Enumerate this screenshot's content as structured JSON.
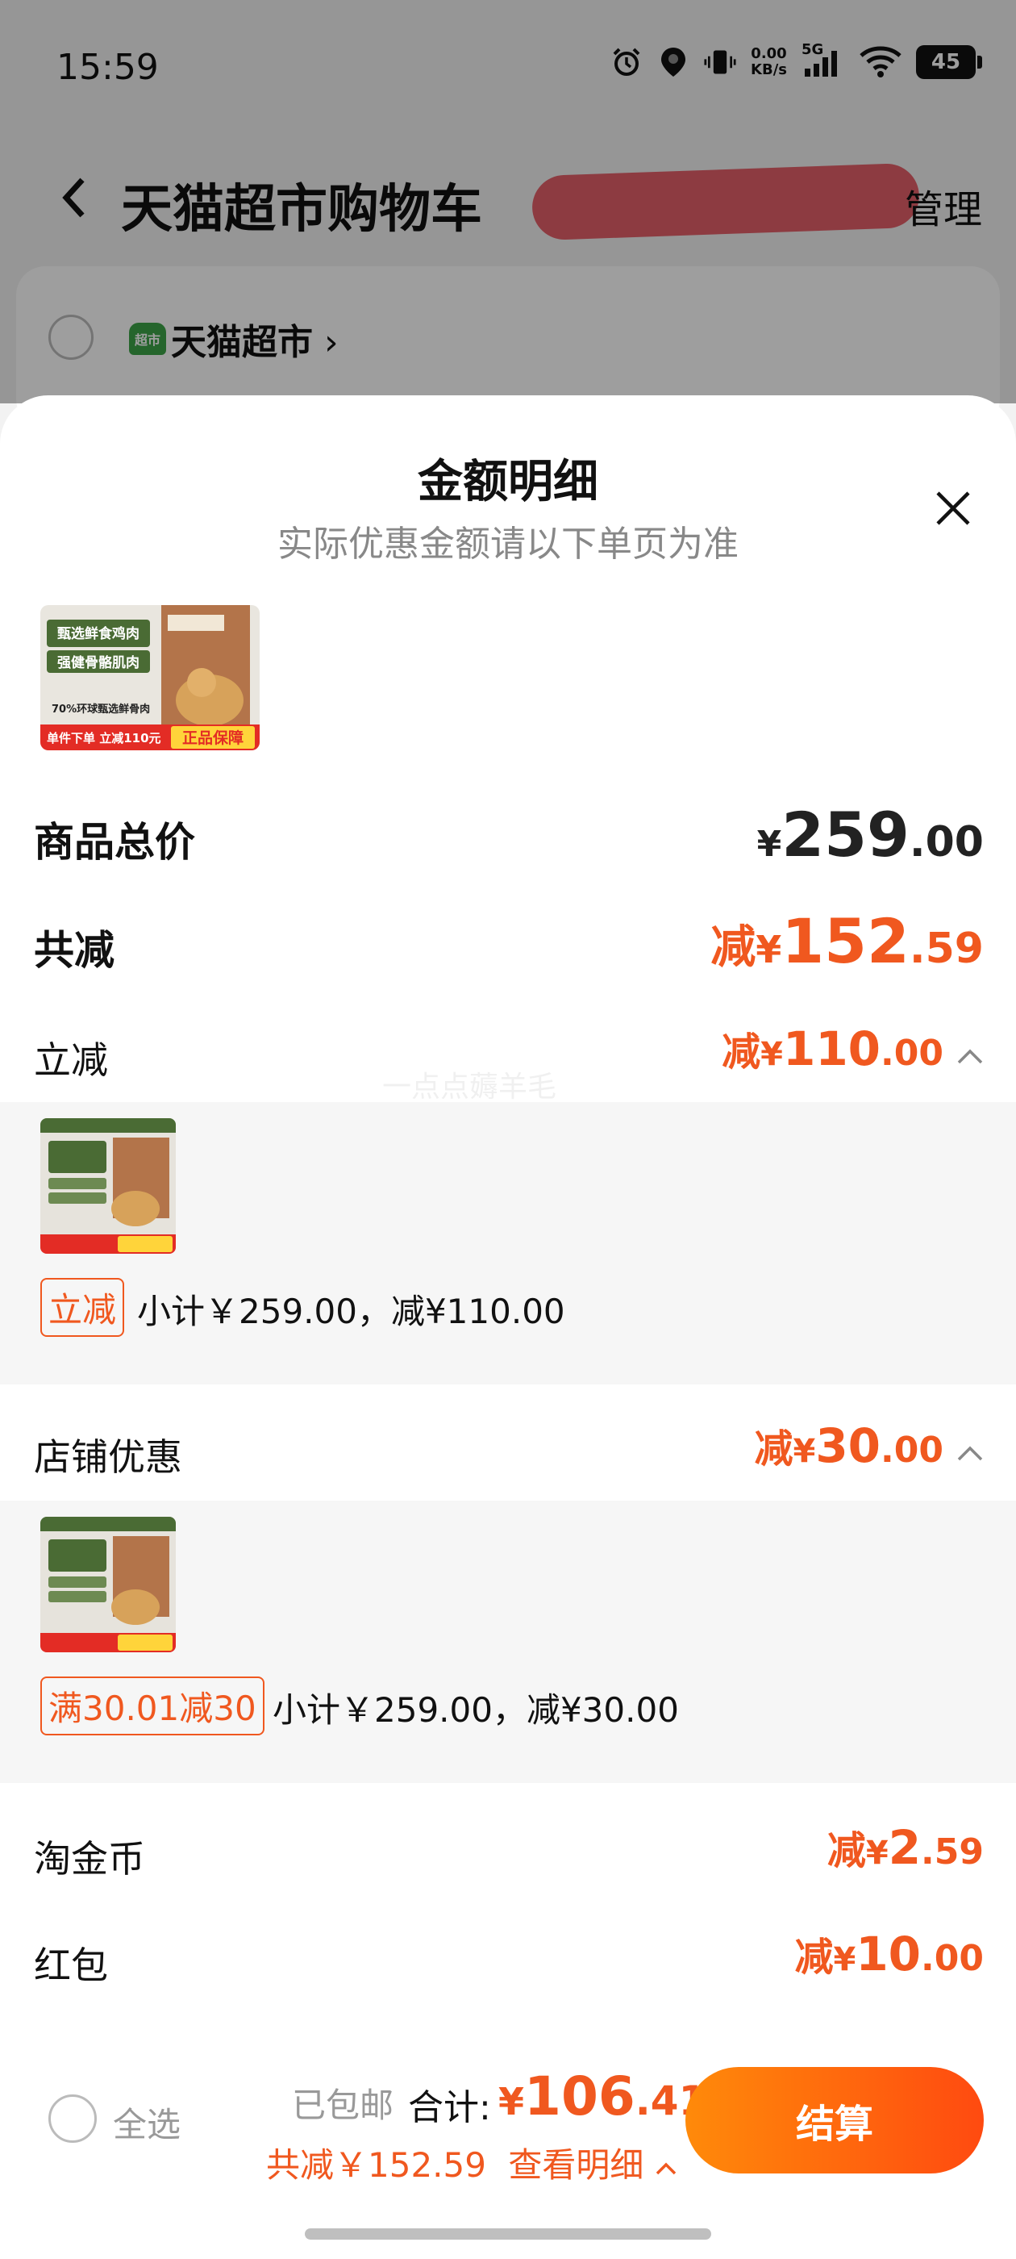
{
  "status_bar": {
    "time": "15:59",
    "net_speed_value": "0.00",
    "net_speed_unit": "KB/s",
    "network": "5G",
    "battery": "45"
  },
  "cart_page": {
    "back_icon": "chevron-left-icon",
    "title": "天猫超市购物车",
    "manage_label": "管理",
    "store_name": "天猫超市",
    "store_logo_text": "超市"
  },
  "sheet": {
    "title": "金额明细",
    "subtitle": "实际优惠金额请以下单页为准",
    "close_icon": "close-icon",
    "product_image": {
      "headline": "甄选鲜食鸡肉",
      "headline2": "强健骨骼肌肉",
      "stat": "70%环球甄选鲜骨肉",
      "promo": "单件下单 立减110元",
      "badge": "正品保障"
    },
    "goods_total": {
      "label": "商品总价",
      "yen": "¥",
      "int": "259",
      "dec": ".00"
    },
    "total_discount": {
      "label": "共减",
      "prefix": "减",
      "yen": "¥",
      "int": "152",
      "dec": ".59"
    },
    "instant_discount": {
      "label": "立减",
      "prefix": "减",
      "yen": "¥",
      "int": "110",
      "dec": ".00",
      "tag": "立减",
      "subtotal": "小计￥259.00，减¥110.00"
    },
    "store_discount": {
      "label": "店铺优惠",
      "prefix": "减",
      "yen": "¥",
      "int": "30",
      "dec": ".00",
      "tag": "满30.01减30",
      "subtotal": "小计￥259.00，减¥30.00"
    },
    "gold_coins": {
      "label": "淘金币",
      "prefix": "减",
      "yen": "¥",
      "int": "2",
      "dec": ".59"
    },
    "red_packet": {
      "label": "红包",
      "prefix": "减",
      "yen": "¥",
      "int": "10",
      "dec": ".00"
    },
    "watermark": "一点点薅羊毛"
  },
  "footer": {
    "select_all": "全选",
    "free_shipping": "已包邮",
    "total_label": "合计:",
    "total_yen": "¥",
    "total_int": "106",
    "total_dec": ".41",
    "discount_summary": "共减￥152.59",
    "view_details": "查看明细",
    "checkout": "结算"
  },
  "colors": {
    "accent": "#f0581f",
    "checkout_gradient_start": "#ff8a0a",
    "checkout_gradient_end": "#ff4a10",
    "overlay": "rgba(0,0,0,0.38)"
  }
}
